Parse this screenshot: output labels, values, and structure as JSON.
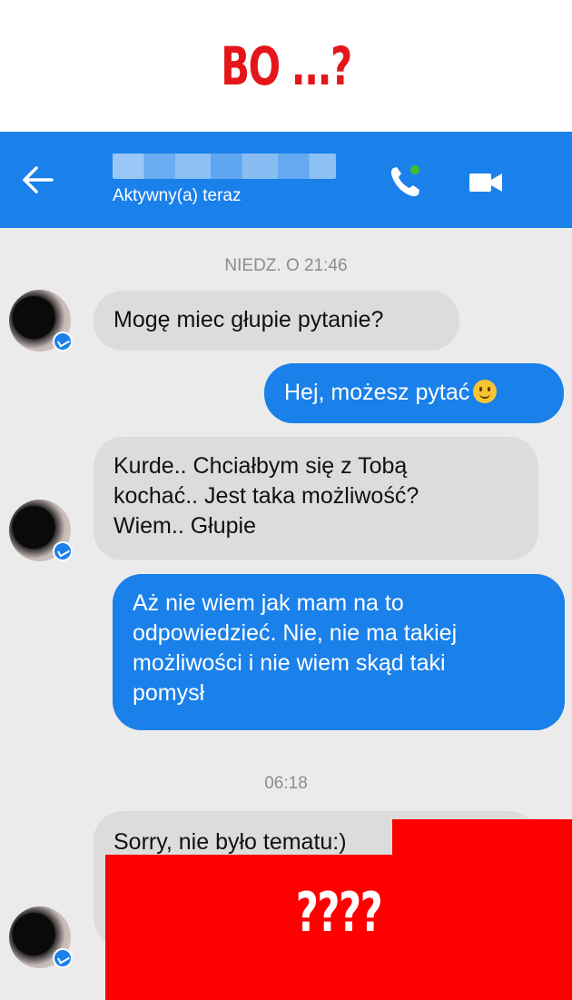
{
  "banner": {
    "title": "BO ...?"
  },
  "topbar": {
    "status": "Aktywny(a) teraz",
    "icons": {
      "back": "back-arrow-icon",
      "phone": "phone-icon",
      "video": "video-camera-icon"
    },
    "color": "#1a80ea"
  },
  "chat": {
    "timestamp_1": "NIEDZ. O 21:46",
    "msg1": {
      "sender": "them",
      "lines": [
        "Mogę miec głupie pytanie?"
      ]
    },
    "msg2": {
      "sender": "me",
      "lines": [
        "Hej, możesz pytać"
      ],
      "emoji": "smiley-emoji"
    },
    "msg3": {
      "sender": "them",
      "lines": [
        "Kurde.. Chciałbym się z Tobą",
        "kochać.. Jest taka możliwość?",
        "Wiem.. Głupie"
      ]
    },
    "msg4": {
      "sender": "me",
      "lines": [
        "Aż nie wiem jak mam na to",
        "odpowiedzieć. Nie, nie ma takiej",
        "możliwości i nie wiem skąd taki",
        "pomysł"
      ]
    },
    "timestamp_2": "06:18",
    "msg5": {
      "sender": "them",
      "lines": [
        "Sorry, nie było tematu:)"
      ]
    }
  },
  "overlay": {
    "text": "????",
    "color": "#fe0000"
  }
}
